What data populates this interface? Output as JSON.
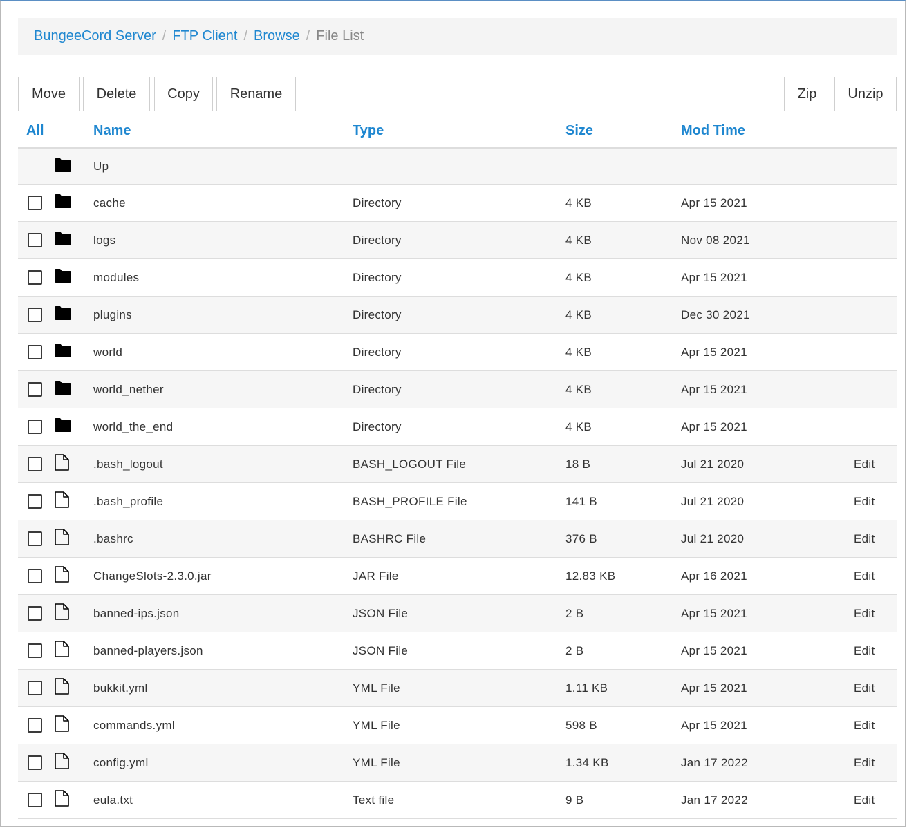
{
  "breadcrumb": {
    "items": [
      "BungeeCord Server",
      "FTP Client",
      "Browse"
    ],
    "current": "File List",
    "separator": "/"
  },
  "toolbar": {
    "move": "Move",
    "delete": "Delete",
    "copy": "Copy",
    "rename": "Rename",
    "zip": "Zip",
    "unzip": "Unzip"
  },
  "table": {
    "headers": {
      "select": "All",
      "name": "Name",
      "type": "Type",
      "size": "Size",
      "mod_time": "Mod Time"
    },
    "up_label": "Up",
    "edit_label": "Edit",
    "rows": [
      {
        "name": "cache",
        "type": "Directory",
        "size": "4 KB",
        "mod_time": "Apr 15 2021",
        "icon": "folder-icon"
      },
      {
        "name": "logs",
        "type": "Directory",
        "size": "4 KB",
        "mod_time": "Nov 08 2021",
        "icon": "folder-icon"
      },
      {
        "name": "modules",
        "type": "Directory",
        "size": "4 KB",
        "mod_time": "Apr 15 2021",
        "icon": "folder-icon"
      },
      {
        "name": "plugins",
        "type": "Directory",
        "size": "4 KB",
        "mod_time": "Dec 30 2021",
        "icon": "folder-icon"
      },
      {
        "name": "world",
        "type": "Directory",
        "size": "4 KB",
        "mod_time": "Apr 15 2021",
        "icon": "folder-icon"
      },
      {
        "name": "world_nether",
        "type": "Directory",
        "size": "4 KB",
        "mod_time": "Apr 15 2021",
        "icon": "folder-icon"
      },
      {
        "name": "world_the_end",
        "type": "Directory",
        "size": "4 KB",
        "mod_time": "Apr 15 2021",
        "icon": "folder-icon"
      },
      {
        "name": ".bash_logout",
        "type": "BASH_LOGOUT File",
        "size": "18 B",
        "mod_time": "Jul 21 2020",
        "icon": "file-icon",
        "editable": true
      },
      {
        "name": ".bash_profile",
        "type": "BASH_PROFILE File",
        "size": "141 B",
        "mod_time": "Jul 21 2020",
        "icon": "file-icon",
        "editable": true
      },
      {
        "name": ".bashrc",
        "type": "BASHRC File",
        "size": "376 B",
        "mod_time": "Jul 21 2020",
        "icon": "file-icon",
        "editable": true
      },
      {
        "name": "ChangeSlots-2.3.0.jar",
        "type": "JAR File",
        "size": "12.83 KB",
        "mod_time": "Apr 16 2021",
        "icon": "file-icon",
        "editable": true
      },
      {
        "name": "banned-ips.json",
        "type": "JSON File",
        "size": "2 B",
        "mod_time": "Apr 15 2021",
        "icon": "file-icon",
        "editable": true
      },
      {
        "name": "banned-players.json",
        "type": "JSON File",
        "size": "2 B",
        "mod_time": "Apr 15 2021",
        "icon": "file-icon",
        "editable": true
      },
      {
        "name": "bukkit.yml",
        "type": "YML File",
        "size": "1.11 KB",
        "mod_time": "Apr 15 2021",
        "icon": "file-icon",
        "editable": true
      },
      {
        "name": "commands.yml",
        "type": "YML File",
        "size": "598 B",
        "mod_time": "Apr 15 2021",
        "icon": "file-icon",
        "editable": true
      },
      {
        "name": "config.yml",
        "type": "YML File",
        "size": "1.34 KB",
        "mod_time": "Jan 17 2022",
        "icon": "file-icon",
        "editable": true
      },
      {
        "name": "eula.txt",
        "type": "Text file",
        "size": "9 B",
        "mod_time": "Jan 17 2022",
        "icon": "file-icon",
        "editable": true
      }
    ]
  },
  "colors": {
    "link": "#1f87d0",
    "breadcrumb_bg": "#f4f4f4",
    "row_alt": "#f6f6f6",
    "border": "#dddddd"
  }
}
